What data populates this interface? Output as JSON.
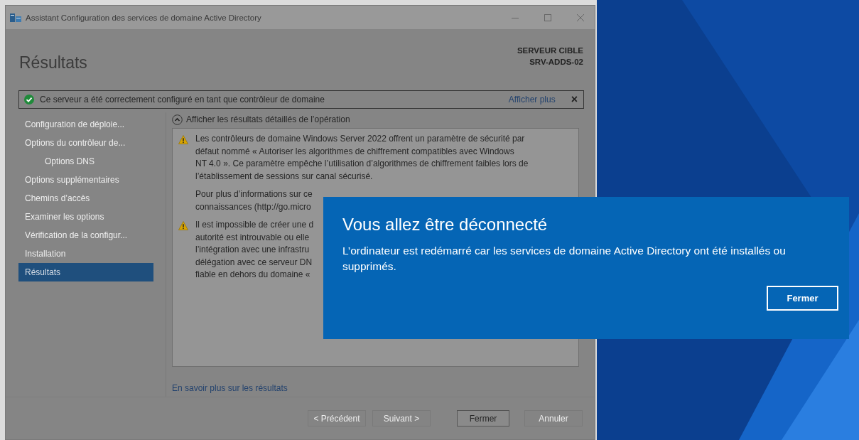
{
  "window": {
    "title": "Assistant Configuration des services de domaine Active Directory"
  },
  "header": {
    "title": "Résultats",
    "target_label": "SERVEUR CIBLE",
    "target_name": "SRV-ADDS-02"
  },
  "notification": {
    "text": "Ce serveur a été correctement configuré en tant que contrôleur de domaine",
    "link": "Afficher plus",
    "close": "×"
  },
  "sidebar": {
    "items": [
      {
        "label": "Configuration de déploie...",
        "selected": false,
        "disabled": true
      },
      {
        "label": "Options du contrôleur de...",
        "selected": false,
        "disabled": true,
        "children": [
          {
            "label": "Options DNS",
            "selected": false,
            "disabled": true
          }
        ]
      },
      {
        "label": "Options supplémentaires",
        "selected": false,
        "disabled": true
      },
      {
        "label": "Chemins d’accès",
        "selected": false,
        "disabled": true
      },
      {
        "label": "Examiner les options",
        "selected": false,
        "disabled": true
      },
      {
        "label": "Vérification de la configur...",
        "selected": false,
        "disabled": true
      },
      {
        "label": "Installation",
        "selected": false,
        "disabled": true
      },
      {
        "label": "Résultats",
        "selected": true,
        "disabled": false
      }
    ]
  },
  "details": {
    "toggle": "Afficher les résultats détaillés de l’opération",
    "expanded": true,
    "messages": [
      {
        "kind": "warning",
        "lines": [
          "Les contrôleurs de domaine Windows Server 2022 offrent un paramètre de sécurité par",
          "défaut nommé « Autoriser les algorithmes de chiffrement compatibles avec Windows",
          "NT 4.0 ». Ce paramètre empêche l’utilisation d’algorithmes de chiffrement faibles lors de",
          "l’établissement de sessions sur canal sécurisé."
        ]
      },
      {
        "kind": "note",
        "lines": [
          "Pour plus d’informations sur ce",
          "connaissances (http://go.micro"
        ]
      },
      {
        "kind": "warning",
        "lines": [
          "Il est impossible de créer une d",
          "autorité est introuvable ou elle",
          "l’intégration avec une infrastru",
          "délégation avec ce serveur DN",
          "fiable en dehors du domaine «"
        ]
      }
    ]
  },
  "learn_more": "En savoir plus sur les résultats",
  "buttons": [
    {
      "label": "< Précédent",
      "disabled": true,
      "default": false
    },
    {
      "label": "Suivant >",
      "disabled": true,
      "default": false
    },
    {
      "label": "Fermer",
      "disabled": false,
      "default": true
    },
    {
      "label": "Annuler",
      "disabled": true,
      "default": false
    }
  ],
  "dialog": {
    "title": "Vous allez être déconnecté",
    "message": "L’ordinateur est redémarré car les services de domaine Active Directory ont été installés ou supprimés.",
    "button": "Fermer"
  }
}
